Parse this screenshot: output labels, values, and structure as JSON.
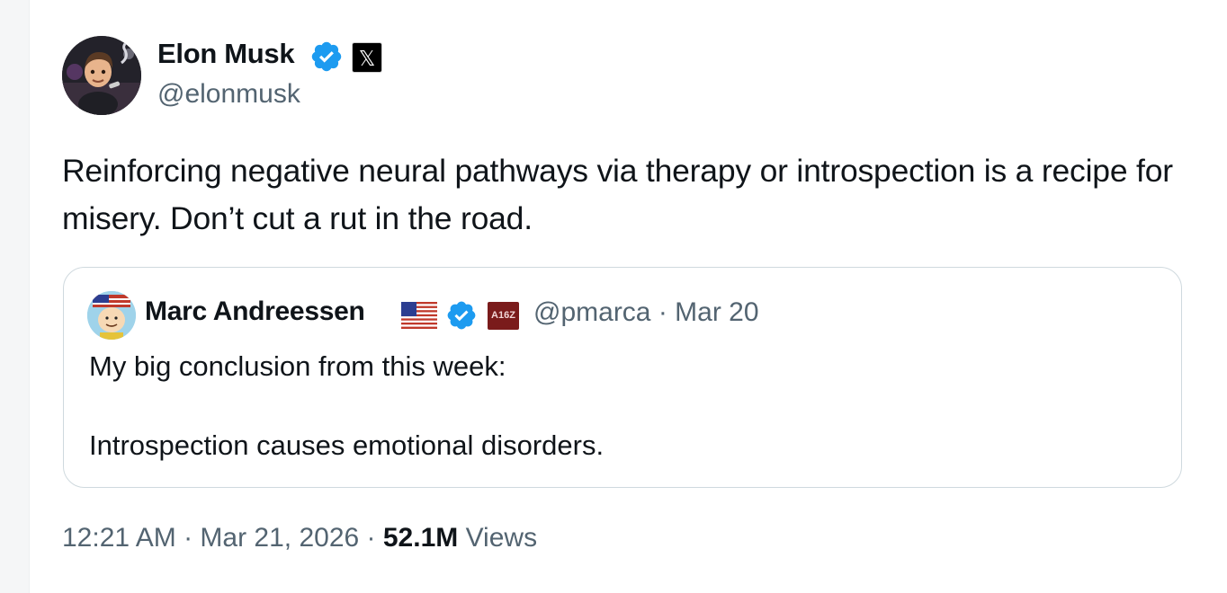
{
  "tweet": {
    "author": {
      "name": "Elon Musk",
      "handle": "@elonmusk",
      "avatar_icon": "avatar-image",
      "verified_color": "#1d9bf0",
      "affiliation_icon": "x-logo-icon",
      "affiliation_glyph": "𝕏"
    },
    "text": "Reinforcing negative neural pathways via therapy or introspection is a recipe for misery. Don’t cut a rut in the road.",
    "quote": {
      "author_name": "Marc Andreessen",
      "flag_icon": "us-flag-icon",
      "affiliation_icon": "a16z-logo-icon",
      "affiliation_text": "A16Z",
      "meta": "@pmarca · Mar 20",
      "text_line1": "My big conclusion from this week:",
      "text_line2": "Introspection causes emotional disorders."
    },
    "footer": {
      "timestamp": "12:21 AM · Mar 21, 2026 · ",
      "views_count": "52.1M",
      "views_label": " Views"
    }
  }
}
